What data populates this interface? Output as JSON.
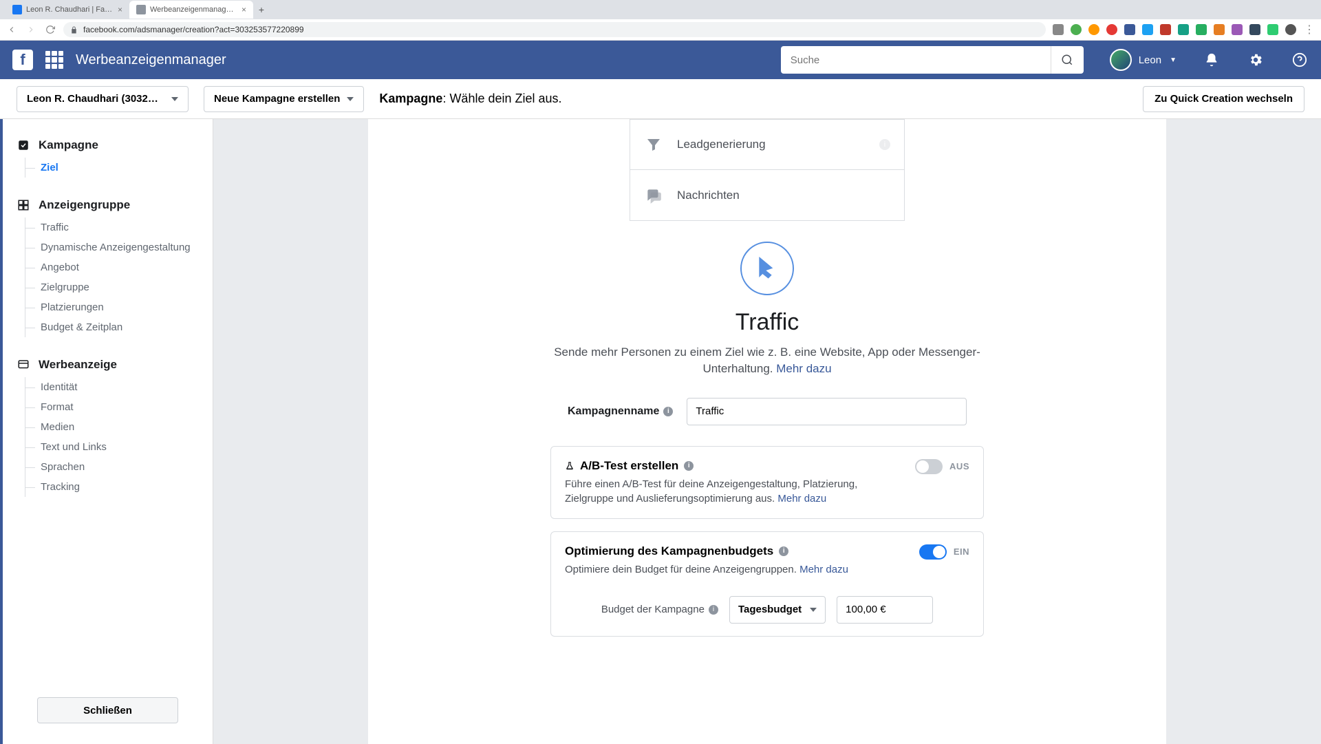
{
  "browser": {
    "tabs": [
      {
        "title": "Leon R. Chaudhari | Facebook",
        "active": false
      },
      {
        "title": "Werbeanzeigenmanager - Cre…",
        "active": true
      }
    ],
    "url": "facebook.com/adsmanager/creation?act=303253577220899"
  },
  "header": {
    "app_title": "Werbeanzeigenmanager",
    "search_placeholder": "Suche",
    "username": "Leon"
  },
  "subheader": {
    "account": "Leon R. Chaudhari (3032…",
    "new_campaign": "Neue Kampagne erstellen",
    "title_bold": "Kampagne",
    "title_rest": ": Wähle dein Ziel aus.",
    "quick": "Zu Quick Creation wechseln"
  },
  "sidebar": {
    "sections": [
      {
        "title": "Kampagne",
        "items": [
          {
            "label": "Ziel",
            "active": true
          }
        ]
      },
      {
        "title": "Anzeigengruppe",
        "items": [
          {
            "label": "Traffic"
          },
          {
            "label": "Dynamische Anzeigengestaltung"
          },
          {
            "label": "Angebot"
          },
          {
            "label": "Zielgruppe"
          },
          {
            "label": "Platzierungen"
          },
          {
            "label": "Budget & Zeitplan"
          }
        ]
      },
      {
        "title": "Werbeanzeige",
        "items": [
          {
            "label": "Identität"
          },
          {
            "label": "Format"
          },
          {
            "label": "Medien"
          },
          {
            "label": "Text und Links"
          },
          {
            "label": "Sprachen"
          },
          {
            "label": "Tracking"
          }
        ]
      }
    ],
    "close": "Schließen"
  },
  "main": {
    "objective_options": [
      {
        "label": "Leadgenerierung",
        "icon": "funnel"
      },
      {
        "label": "Nachrichten",
        "icon": "messages"
      }
    ],
    "hero": {
      "title": "Traffic",
      "desc": "Sende mehr Personen zu einem Ziel wie z. B. eine Website, App oder Messenger-Unterhaltung. ",
      "more": "Mehr dazu"
    },
    "campaign_name": {
      "label": "Kampagnenname",
      "value": "Traffic"
    },
    "ab_test": {
      "title": "A/B-Test erstellen",
      "desc": "Führe einen A/B-Test für deine Anzeigengestaltung, Platzierung, Zielgruppe und Auslieferungsoptimierung aus. ",
      "more": "Mehr dazu",
      "state_label": "AUS"
    },
    "budget_opt": {
      "title": "Optimierung des Kampagnenbudgets",
      "desc": "Optimiere dein Budget für deine Anzeigengruppen. ",
      "more": "Mehr dazu",
      "state_label": "EIN",
      "budget_label": "Budget der Kampagne",
      "type": "Tagesbudget",
      "value": "100,00 €"
    }
  }
}
